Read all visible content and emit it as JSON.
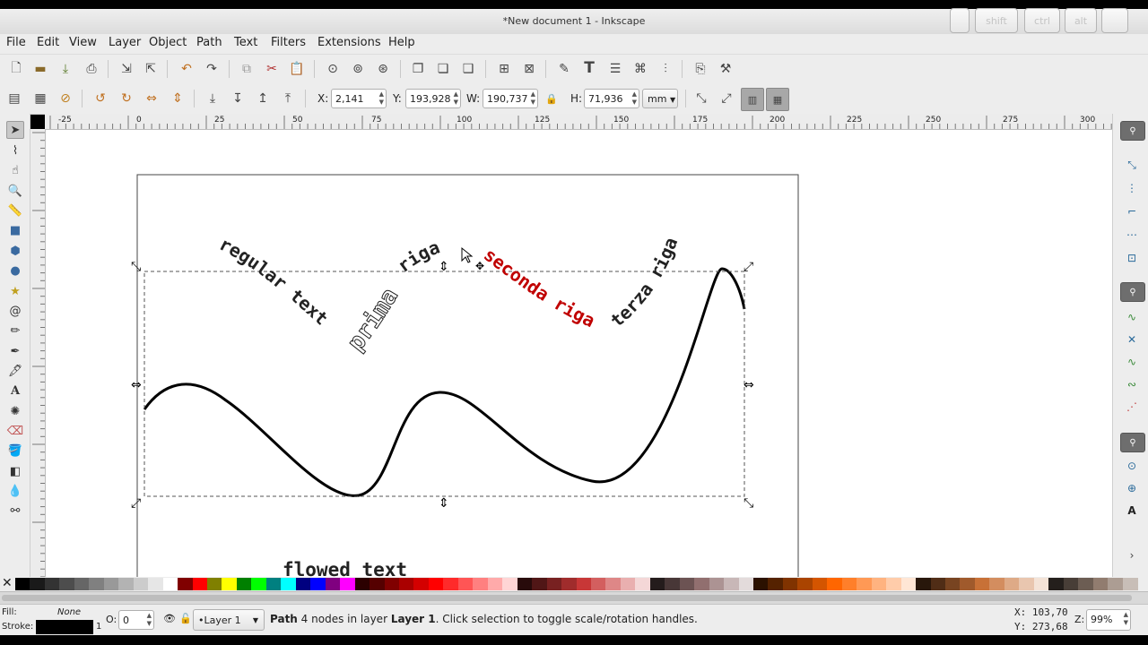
{
  "window": {
    "title": "*New document 1 - Inkscape",
    "modifier_keys": [
      "",
      "shift",
      "ctrl",
      "alt",
      ""
    ]
  },
  "menu": [
    "File",
    "Edit",
    "View",
    "Layer",
    "Object",
    "Path",
    "Text",
    "Filters",
    "Extensions",
    "Help"
  ],
  "selector_toolbar": {
    "x_label": "X:",
    "x_value": "2,141",
    "y_label": "Y:",
    "y_value": "193,928",
    "w_label": "W:",
    "w_value": "190,737",
    "h_label": "H:",
    "h_value": "71,936",
    "unit": "mm"
  },
  "rulers": {
    "horizontal_ticks": [
      "-25",
      "0",
      "25",
      "50",
      "75",
      "100",
      "125",
      "150",
      "175",
      "200",
      "225",
      "250",
      "275",
      "300"
    ]
  },
  "canvas": {
    "texts": {
      "regular": "regular text",
      "prima": "prima",
      "riga1": "riga",
      "seconda": "seconda riga",
      "terza": "terza riga",
      "flowed": "flowed text"
    },
    "colors": {
      "red_text": "#c00000",
      "path": "#000000"
    }
  },
  "palette": {
    "colors": [
      "#000000",
      "#1a1a1a",
      "#333333",
      "#4d4d4d",
      "#666666",
      "#808080",
      "#999999",
      "#b3b3b3",
      "#cccccc",
      "#e6e6e6",
      "#ffffff",
      "#800000",
      "#ff0000",
      "#808000",
      "#ffff00",
      "#008000",
      "#00ff00",
      "#008080",
      "#00ffff",
      "#000080",
      "#0000ff",
      "#800080",
      "#ff00ff",
      "#2b0000",
      "#550000",
      "#800000",
      "#aa0000",
      "#d40000",
      "#ff0000",
      "#ff2a2a",
      "#ff5555",
      "#ff8080",
      "#ffaaaa",
      "#ffd5d5",
      "#280b0b",
      "#501616",
      "#782121",
      "#a02c2c",
      "#c83737",
      "#d35f5f",
      "#de8787",
      "#e9afaf",
      "#f4d7d7",
      "#241c1c",
      "#483737",
      "#6c5353",
      "#916f6f",
      "#ac9393",
      "#c8b7b7",
      "#e3dbdb",
      "#2b1100",
      "#552200",
      "#803300",
      "#aa4400",
      "#d45500",
      "#ff6600",
      "#ff7f2a",
      "#ff9955",
      "#ffb380",
      "#ffccaa",
      "#ffe6d5",
      "#28170b",
      "#502d16",
      "#784421",
      "#a05a2c",
      "#c87137",
      "#d38d5f",
      "#deaa87",
      "#e9c6af",
      "#f4e3d7",
      "#241f1c",
      "#483e37",
      "#6c5d53",
      "#917c6f",
      "#ac9d93",
      "#c8beb7"
    ]
  },
  "status": {
    "fill_label": "Fill:",
    "fill_value": "None",
    "stroke_label": "Stroke:",
    "stroke_width": "1",
    "opacity_label": "O:",
    "opacity_value": "0",
    "layer": "•Layer 1",
    "message_prefix": "Path",
    "message_mid": " 4 nodes in layer ",
    "message_layer": "Layer 1",
    "message_suffix": ". Click selection to toggle scale/rotation handles.",
    "x_coord": "X: 103,70",
    "y_coord": "Y: 273,68",
    "zoom_label": "Z:",
    "zoom": "99%"
  }
}
